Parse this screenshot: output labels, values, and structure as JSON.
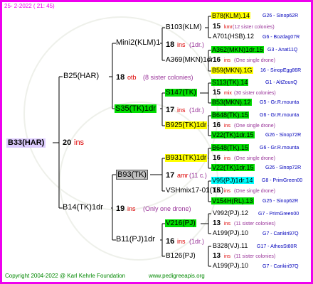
{
  "header": {
    "date": "25-  2-2022 ( 21: 45)"
  },
  "footer": {
    "copyright": "Copyright 2004-2022 @ Karl Kehrle Foundation",
    "website": "www.pedigreeapis.org"
  },
  "colors": {
    "border": "#ee00ee",
    "yellow": "#ffff00",
    "green": "#00dd00",
    "cyan": "#00ffff",
    "grey": "#c0c0c0",
    "lavender": "#ddccff",
    "red": "#dd0000",
    "blue": "#0000bb",
    "purple": "#993399"
  },
  "root": {
    "name": "B33(HAR)",
    "count": "20",
    "suffix": "ins"
  },
  "gen1": {
    "top": {
      "name": "B25(HAR)",
      "count": "18",
      "suffix": "otb",
      "note": "(8 sister colonies)"
    },
    "bottom": {
      "name": "B14(TK)1dr",
      "count": "19",
      "suffix": "ins",
      "note": "(Only one drone)"
    }
  },
  "gen2": {
    "a": {
      "name": "Mini2(KLM)1",
      "count": "18",
      "suffix": "ins",
      "note": "(1dr.)"
    },
    "b": {
      "name": "S35(TK)1dr",
      "count": "17",
      "suffix": "ins",
      "note": "(1dr.)"
    },
    "c": {
      "name": "B93(TK)",
      "count": "17",
      "suffix": "amr",
      "note": "(11 c.)"
    },
    "d": {
      "name": "B11(PJ)1dr",
      "count": "16",
      "suffix": "ins",
      "note": "(1dr.)"
    }
  },
  "gen3": {
    "a1": {
      "name": "B103(KLM)"
    },
    "a2": {
      "name": "A369(MKN)1dr"
    },
    "b1": {
      "name": "S147(TK)"
    },
    "b2": {
      "name": "B925(TK)1dr"
    },
    "c1": {
      "name": "B931(TK)1dr"
    },
    "c2": {
      "name": "VSHmix17-01(TK)"
    },
    "d1": {
      "name": "V216(PJ)"
    },
    "d2": {
      "name": "B126(PJ)"
    }
  },
  "gen4": {
    "r1": {
      "name": "B78(KLM).14",
      "code": "G26 - Sinop62R"
    },
    "r2": {
      "count": "15",
      "suffix": "kmr",
      "note": "(12 sister colonies)"
    },
    "r3": {
      "name": "A701(HSB).12",
      "code": "G6 - Bozdag07R"
    },
    "r4": {
      "name": "A362(MKN)1dr.15",
      "code": "G3 - Anat11Q"
    },
    "r5": {
      "count": "16",
      "suffix": "ins",
      "note": "(One single drone)"
    },
    "r6": {
      "name": "B59(MKN).1G",
      "code": "16 - SinopEgg86R"
    },
    "r7": {
      "name": "S113(TK).14",
      "code": "G1 - AltZounQ"
    },
    "r8": {
      "count": "15",
      "suffix": "mix",
      "note": "(30 sister colonies)"
    },
    "r9": {
      "name": "B53(MKN).12",
      "code": "G5 - Gr.R.mounta"
    },
    "r10": {
      "name": "B648(TK).15",
      "code": "G6 - Gr.R.mounta"
    },
    "r11": {
      "count": "16",
      "suffix": "ins",
      "note": "(One single drone)"
    },
    "r12": {
      "name": "V22(TK)1dr.15",
      "code": "G26 - Sinop72R"
    },
    "r13": {
      "name": "B648(TK).15",
      "code": "G6 - Gr.R.mounta"
    },
    "r14": {
      "count": "16",
      "suffix": "ins",
      "note": "(One single drone)"
    },
    "r15": {
      "name": "V22(TK)1dr.15",
      "code": "G26 - Sinop72R"
    },
    "r16": {
      "name": "V95(PJ)1dr.14",
      "code": "G8 - PrimGreen00"
    },
    "r17": {
      "count": "15",
      "suffix": "ins",
      "note": "(One single drone)"
    },
    "r18": {
      "name": "V154H(RL).13",
      "code": "G25 - Sinop62R"
    },
    "r19": {
      "name": "V992(PJ).12",
      "code": "G7 - PrimGreen00"
    },
    "r20": {
      "count": "13",
      "suffix": "ins",
      "note": "(11 sister colonies)"
    },
    "r21": {
      "name": "A199(PJ).10",
      "code": "G7 - Cankiri97Q"
    },
    "r22": {
      "name": "B328(VJ).11",
      "code": "G17 - AthosSt80R"
    },
    "r23": {
      "count": "13",
      "suffix": "ins",
      "note": "(11 sister colonies)"
    },
    "r24": {
      "name": "A199(PJ).10",
      "code": "G7 - Cankiri97Q"
    }
  }
}
